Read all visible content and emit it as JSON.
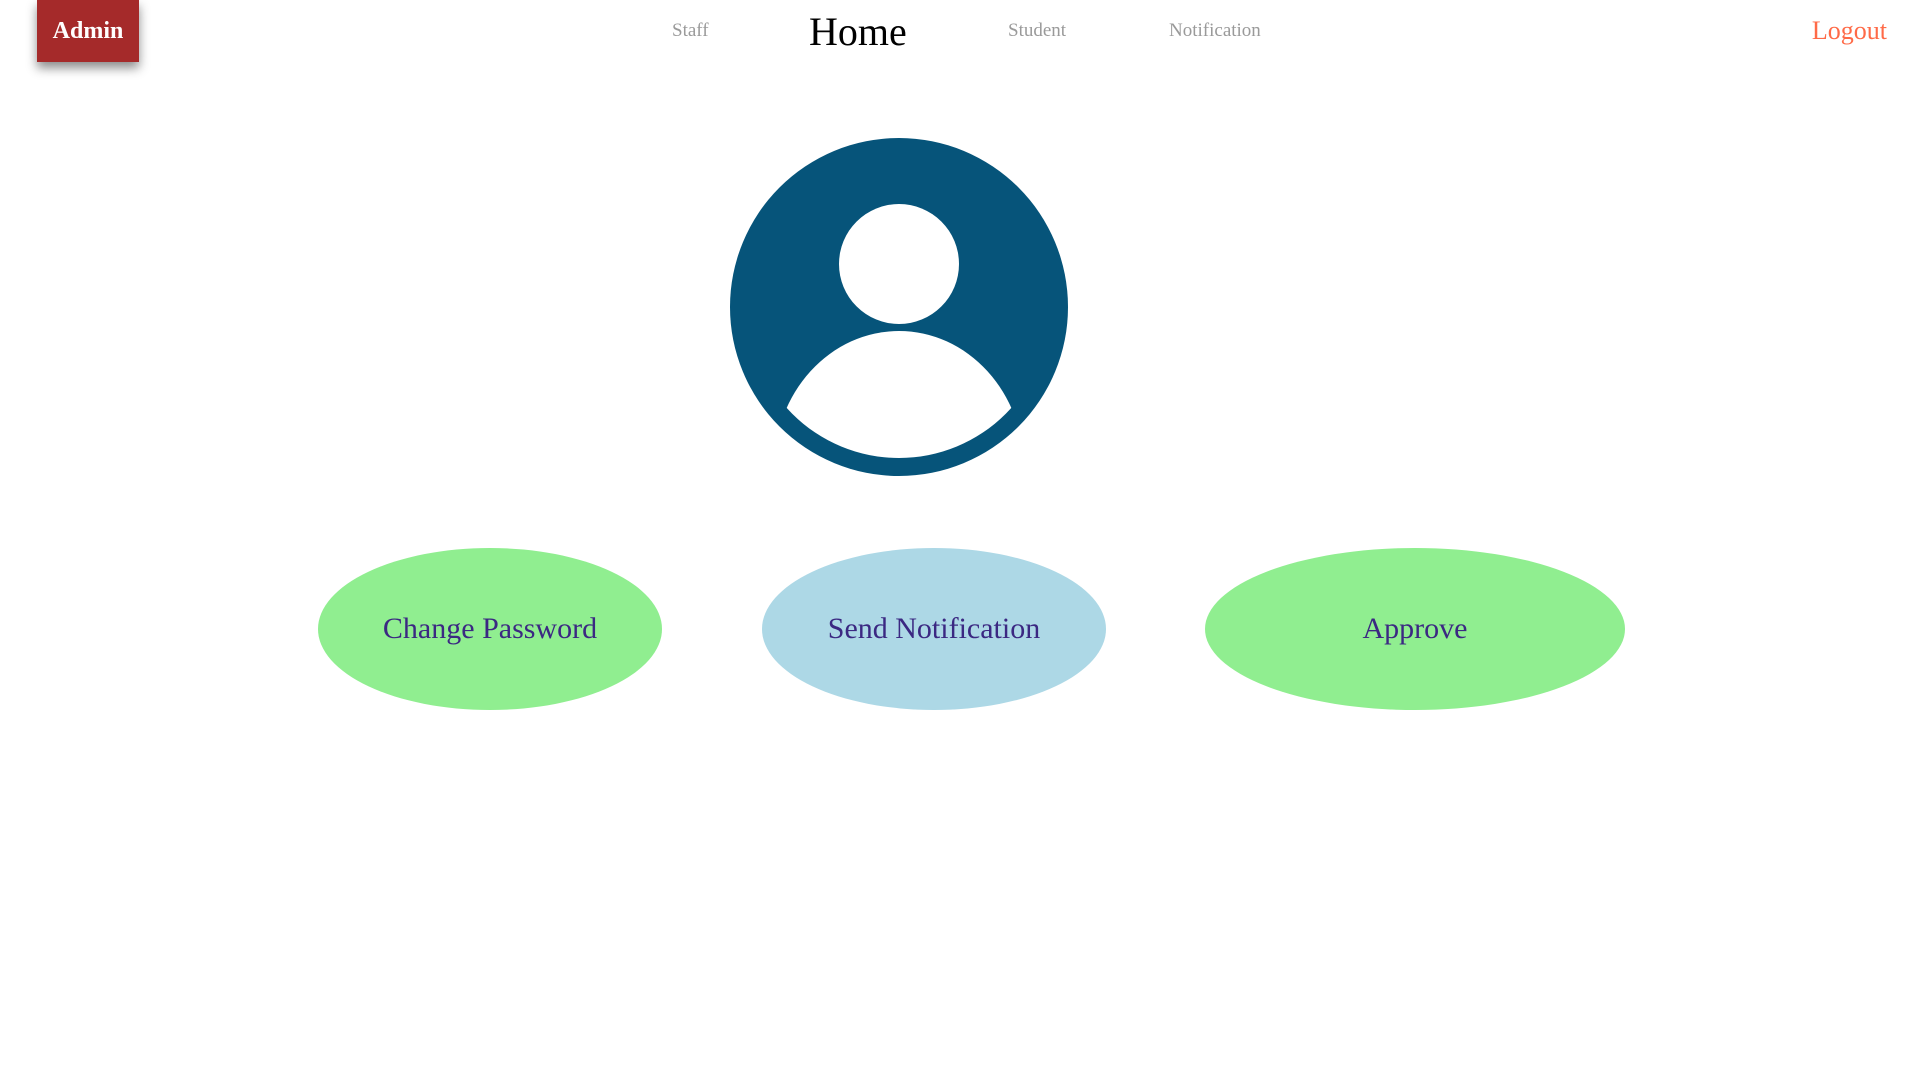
{
  "header": {
    "brand_label": "Admin",
    "nav": {
      "staff": "Staff",
      "home": "Home",
      "student": "Student",
      "notification": "Notification",
      "logout": "Logout"
    }
  },
  "avatar": {
    "icon": "user-circle-icon",
    "color": "#06547a"
  },
  "actions": {
    "change_password": "Change Password",
    "send_notification": "Send Notification",
    "approve": "Approve"
  },
  "colors": {
    "brand_badge": "#a52a2a",
    "logout": "#ff6a47",
    "button_green": "#90ee90",
    "button_blue": "#add8e6",
    "button_text": "#3b2882"
  }
}
